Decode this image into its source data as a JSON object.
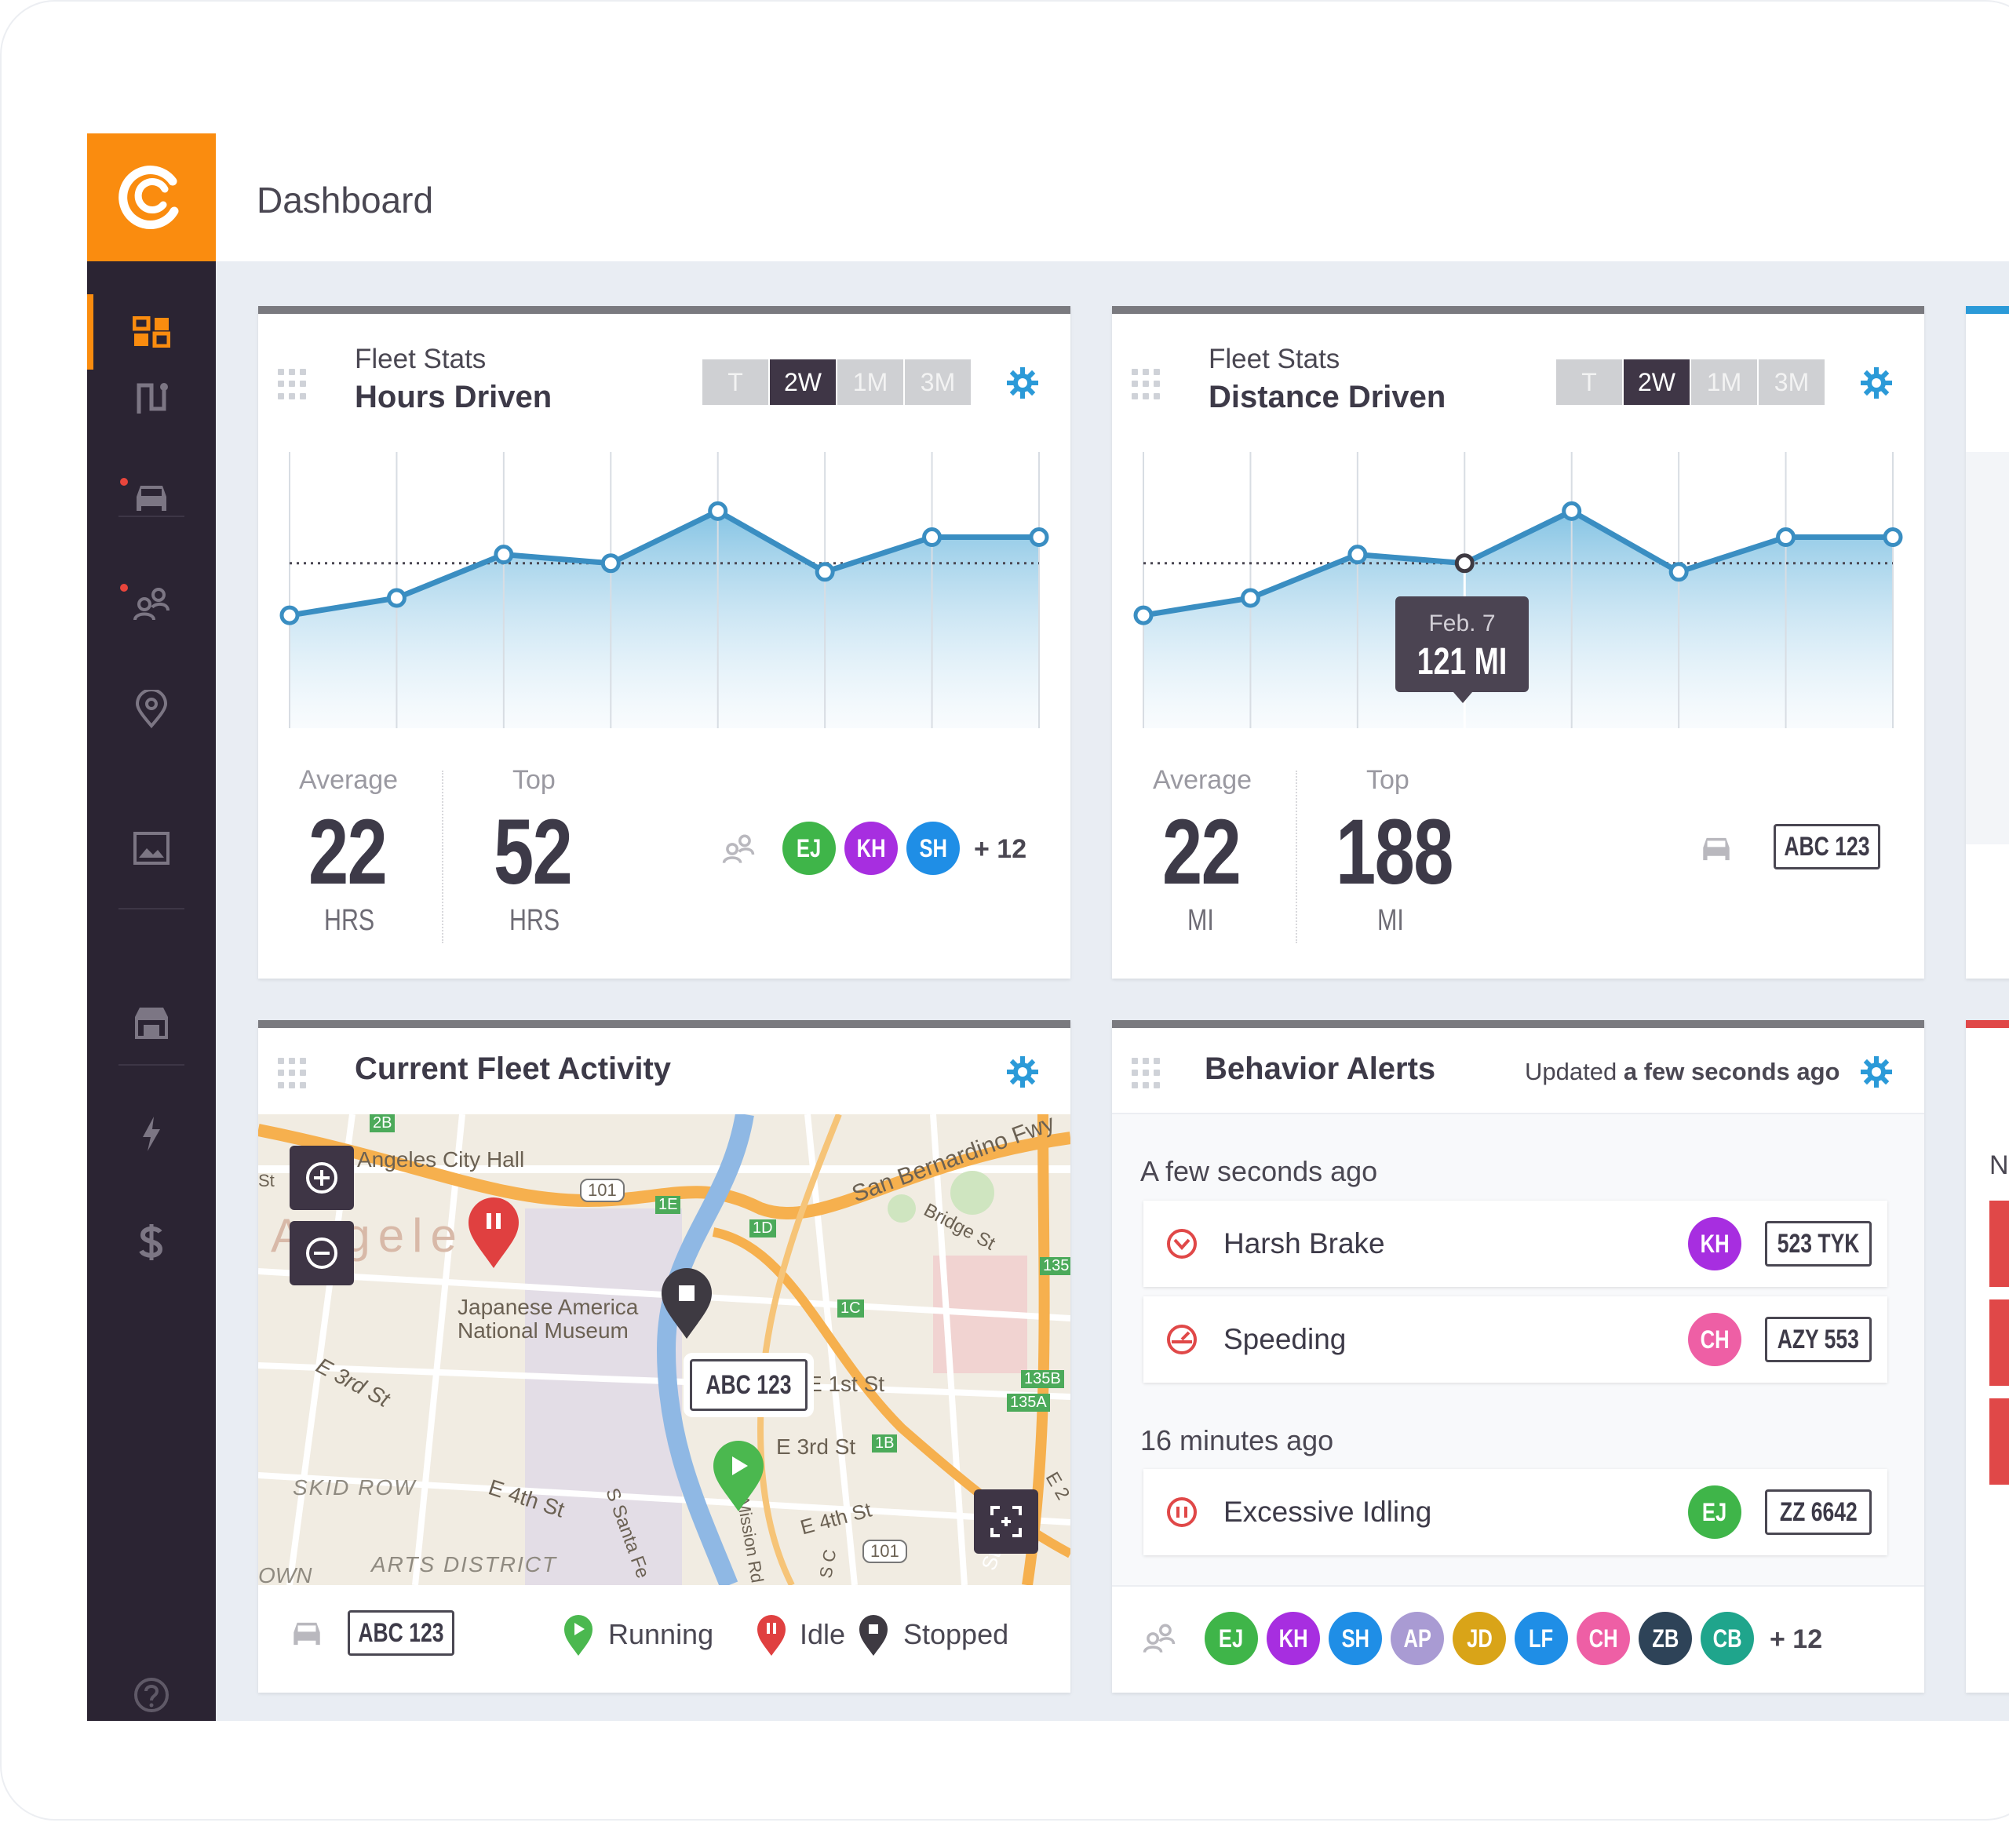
{
  "page": {
    "title": "Dashboard"
  },
  "sidebar": {
    "items": [
      {
        "icon": "dashboard-icon",
        "active": true
      },
      {
        "icon": "route-icon"
      },
      {
        "icon": "vehicle-icon",
        "alert": true
      },
      {
        "icon": "drivers-icon",
        "alert": true
      },
      {
        "icon": "location-pin-icon"
      },
      {
        "icon": "image-icon"
      },
      {
        "icon": "garage-icon"
      },
      {
        "icon": "lightning-icon"
      },
      {
        "icon": "dollar-icon"
      },
      {
        "icon": "help-icon"
      }
    ]
  },
  "colors": {
    "accent": "#fa8c0f",
    "sidebar": "#2b2433",
    "line": "#3a8ec2",
    "gear": "#2b9ad8"
  },
  "time_ranges": [
    "T",
    "2W",
    "1M",
    "3M"
  ],
  "selected_range": "2W",
  "hours_card": {
    "subtitle": "Fleet Stats",
    "title": "Hours Driven",
    "average_label": "Average",
    "average_value": "22",
    "average_unit": "HRS",
    "top_label": "Top",
    "top_value": "52",
    "top_unit": "HRS",
    "drivers": [
      "EJ",
      "KH",
      "SH"
    ],
    "more": "+ 12"
  },
  "distance_card": {
    "subtitle": "Fleet Stats",
    "title": "Distance Driven",
    "average_label": "Average",
    "average_value": "22",
    "average_unit": "MI",
    "top_label": "Top",
    "top_value": "188",
    "top_unit": "MI",
    "plate": "ABC 123",
    "tooltip_date": "Feb. 7",
    "tooltip_value": "121 MI"
  },
  "chart_data": [
    {
      "type": "area",
      "series": [
        {
          "values": [
            13,
            15,
            20,
            19,
            25,
            18,
            22,
            22
          ]
        }
      ],
      "average": 19,
      "ylim": [
        0,
        30
      ]
    },
    {
      "type": "area",
      "series": [
        {
          "values": [
            13,
            15,
            20,
            19,
            25,
            18,
            22,
            22
          ]
        }
      ],
      "average": 19,
      "ylim": [
        0,
        30
      ],
      "highlight_index": 3
    }
  ],
  "fleet_card": {
    "title": "Current Fleet Activity",
    "map_labels": {
      "city_hall": "Angeles City Hall",
      "big_name": "Angele",
      "museum_1": "Japanese America",
      "museum_2": "National Museum",
      "e3rd": "E 3rd St",
      "skid_row": "SKID ROW",
      "e4th": "E 4th St",
      "santa_fe": "S Santa Fe",
      "arts": "ARTS DISTRICT",
      "own": "OWN",
      "fwy": "San Bernardino Fwy",
      "bridge": "Bridge St",
      "first": "E 1st St",
      "e3rd_b": "E 3rd St",
      "e4th_b": "E 4th St",
      "mission": "S Mission Rd",
      "state": "State",
      "r101a": "101",
      "r101b": "101",
      "s1e": "1E",
      "s1d": "1D",
      "s1c": "1C",
      "s1b": "1B",
      "s2b": "2B",
      "s135": "135",
      "s135b": "135B",
      "s135a": "135A",
      "st": "St",
      "e2": "E 2",
      "sc": "S C"
    },
    "map_plate": "ABC 123",
    "footer_plate": "ABC 123",
    "legend": {
      "running": "Running",
      "idle": "Idle",
      "stopped": "Stopped"
    }
  },
  "alerts_card": {
    "title": "Behavior Alerts",
    "updated_prefix": "Updated",
    "updated_value": "a few seconds ago",
    "groups": [
      {
        "time": "A few seconds ago",
        "alerts": [
          {
            "name": "Harsh Brake",
            "driver": "KH",
            "plate": "523 TYK"
          },
          {
            "name": "Speeding",
            "driver": "CH",
            "plate": "AZY 553"
          }
        ]
      },
      {
        "time": "16 minutes ago",
        "alerts": [
          {
            "name": "Excessive Idling",
            "driver": "EJ",
            "plate": "ZZ 6642"
          }
        ]
      }
    ],
    "drivers": [
      "EJ",
      "KH",
      "SH",
      "AP",
      "JD",
      "LF",
      "CH",
      "ZB",
      "CB"
    ],
    "more": "+ 12"
  },
  "partial_right": {
    "letter": "N"
  }
}
